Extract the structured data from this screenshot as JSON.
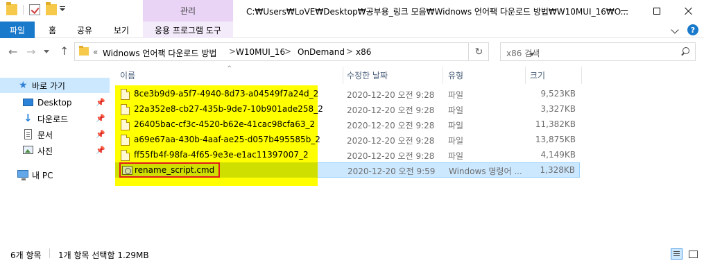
{
  "titlebar": {
    "context_tab": "관리",
    "title": "C:₩Users₩LoVE₩Desktop₩공부용_링크 모음₩Widnows 언어팩 다운로드 방법₩W10MUI_16₩O..."
  },
  "ribbon": {
    "file": "파일",
    "home": "홈",
    "share": "공유",
    "view": "보기",
    "app_tools": "응용 프로그램 도구",
    "help": "?"
  },
  "address": {
    "more": "«",
    "crumbs": [
      "Widnows 언어팩 다운로드 방법",
      "W10MUI_16",
      "OnDemand",
      "x86"
    ],
    "separator": ">"
  },
  "search": {
    "placeholder": "x86 검색"
  },
  "navpane": {
    "quick_access": "바로 가기",
    "items": [
      {
        "label": "Desktop",
        "icon": "desktop-icon"
      },
      {
        "label": "다운로드",
        "icon": "download-icon"
      },
      {
        "label": "문서",
        "icon": "document-icon"
      },
      {
        "label": "사진",
        "icon": "pictures-icon"
      }
    ],
    "this_pc": "내 PC"
  },
  "columns": {
    "name": "이름",
    "date": "수정한 날짜",
    "type": "유형",
    "size": "크기"
  },
  "files": [
    {
      "name": "8ce3b9d9-a5f7-4940-8d73-a04549f7a24d_2",
      "date": "2020-12-20 오전 9:28",
      "type": "파일",
      "size": "9,523KB"
    },
    {
      "name": "22a352e8-cb27-435b-9de7-10b901ade258_2",
      "date": "2020-12-20 오전 9:28",
      "type": "파일",
      "size": "3,327KB"
    },
    {
      "name": "26405bac-cf3c-4520-b62e-41cac98cfa63_2",
      "date": "2020-12-20 오전 9:28",
      "type": "파일",
      "size": "11,382KB"
    },
    {
      "name": "a69e67aa-430b-4aaf-ae25-d057b495585b_2",
      "date": "2020-12-20 오전 9:28",
      "type": "파일",
      "size": "13,875KB"
    },
    {
      "name": "ff55fb4f-98fa-4f65-9e3e-e1ac11397007_2",
      "date": "2020-12-20 오전 9:28",
      "type": "파일",
      "size": "4,149KB"
    },
    {
      "name": "rename_script.cmd",
      "date": "2020-12-20 오전 9:59",
      "type": "Windows 명령어 ...",
      "size": "1,328KB"
    }
  ],
  "status": {
    "count": "6개 항목",
    "selection": "1개 항목 선택함 1.29MB"
  },
  "colors": {
    "accent": "#1979ca",
    "highlight": "#ffff00",
    "selection": "#cce8ff",
    "annotation_box": "#e01b1b",
    "context_tab": "#e9d4f5"
  }
}
